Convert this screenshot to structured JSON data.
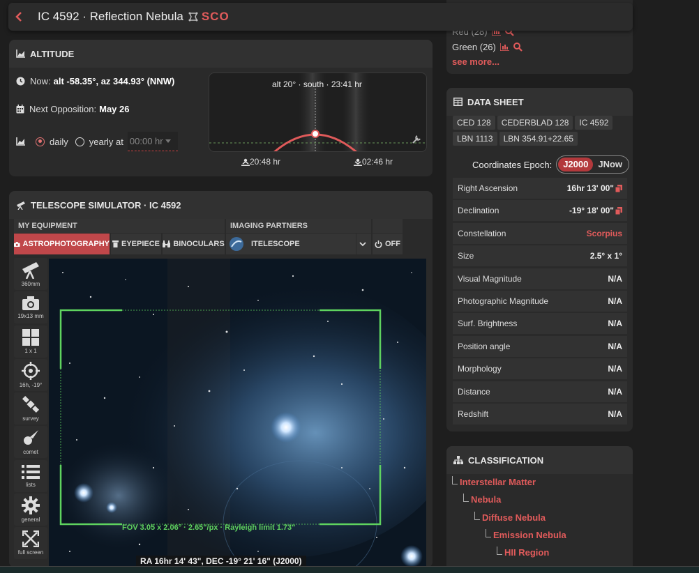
{
  "header": {
    "title": "IC 4592 · Reflection Nebula",
    "constellation": "SCO"
  },
  "altitude": {
    "heading": "ALTITUDE",
    "now_label": "Now:",
    "now_value": "alt -58.35°, az 344.93° (NNW)",
    "opposition_label": "Next Opposition:",
    "opposition_value": "May 26",
    "mode_daily": "daily",
    "mode_yearly": "yearly at",
    "time_placeholder": "00:00 hr",
    "chart_label": "alt 20° · south · 23:41 hr",
    "rise_time": "20:48 hr",
    "set_time": "02:46 hr"
  },
  "telescope": {
    "heading": "TELESCOPE SIMULATOR · IC 4592",
    "group_equipment": "MY EQUIPMENT",
    "group_partners": "IMAGING PARTNERS",
    "tabs": {
      "astrophotography": "ASTROPHOTOGRAPHY",
      "eyepiece": "EYEPIECE",
      "binoculars": "BINOCULARS",
      "partner": "ITELESCOPE",
      "off": "OFF"
    },
    "sidebar": {
      "telescope": "360mm",
      "camera": "19x13 mm",
      "mosaic": "1 x 1",
      "target": "16h, -19°",
      "survey": "survey",
      "comet": "comet",
      "lists": "lists",
      "general": "general",
      "fullscreen": "full screen"
    },
    "fov_text": "FOV 3.05 x 2.06° · 2.65\"/px · Rayleigh limit 1.73\"",
    "radec_text": "RA 16hr 14' 43\", DEC -19° 21' 16\" (J2000)"
  },
  "similar": {
    "row1_label": "Red (28)",
    "row2_label": "Green (26)",
    "see_more": "see more..."
  },
  "datasheet": {
    "heading": "DATA SHEET",
    "catalogs": [
      "CED 128",
      "CEDERBLAD 128",
      "IC 4592",
      "LBN 1113",
      "LBN 354.91+22.65"
    ],
    "epoch_label": "Coordinates Epoch:",
    "epoch_j2000": "J2000",
    "epoch_jnow": "JNow",
    "rows": [
      {
        "key": "Right Ascension",
        "value": "16hr 13' 00\""
      },
      {
        "key": "Declination",
        "value": "-19° 18' 00\""
      },
      {
        "key": "Constellation",
        "value": "Scorpius"
      },
      {
        "key": "Size",
        "value": "2.5° x 1°"
      },
      {
        "key": "Visual Magnitude",
        "value": "N/A"
      },
      {
        "key": "Photographic Magnitude",
        "value": "N/A"
      },
      {
        "key": "Surf. Brightness",
        "value": "N/A"
      },
      {
        "key": "Position angle",
        "value": "N/A"
      },
      {
        "key": "Morphology",
        "value": "N/A"
      },
      {
        "key": "Distance",
        "value": "N/A"
      },
      {
        "key": "Redshift",
        "value": "N/A"
      }
    ]
  },
  "classification": {
    "heading": "CLASSIFICATION",
    "levels": [
      "Interstellar Matter",
      "Nebula",
      "Diffuse Nebula",
      "Emission Nebula",
      "HII Region"
    ]
  },
  "colors": {
    "accent": "#e15b5b",
    "fov": "#5fd35f"
  }
}
